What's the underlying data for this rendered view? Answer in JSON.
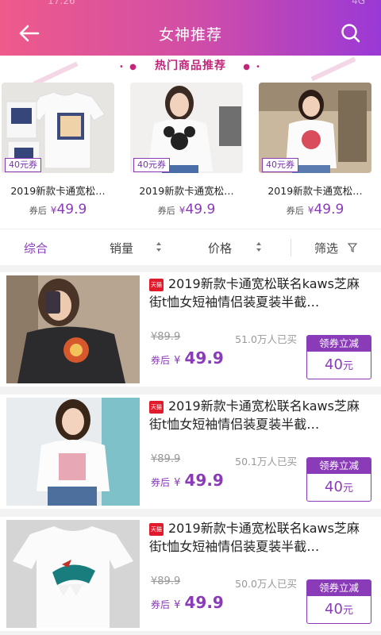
{
  "status_bar": {
    "time": "17:26",
    "signal": "4G"
  },
  "header": {
    "title": "女神推荐"
  },
  "hot": {
    "section_title": "热门商品推荐",
    "items": [
      {
        "coupon": "40元券",
        "name": "2019新款卡通宽松…",
        "price_label": "券后",
        "currency": "¥",
        "price": "49.9"
      },
      {
        "coupon": "40元券",
        "name": "2019新款卡通宽松…",
        "price_label": "券后",
        "currency": "¥",
        "price": "49.9"
      },
      {
        "coupon": "40元券",
        "name": "2019新款卡通宽松…",
        "price_label": "券后",
        "currency": "¥",
        "price": "49.9"
      }
    ]
  },
  "filter": {
    "items": [
      {
        "label": "综合"
      },
      {
        "label": "销量"
      },
      {
        "label": "价格"
      },
      {
        "label": "筛选"
      }
    ]
  },
  "products": [
    {
      "badge": "天猫",
      "name": "2019新款卡通宽松联名kaws芝麻街t恤女短袖情侣装夏装半截…",
      "original_price": "¥89.9",
      "sold": "51.0万人已买",
      "price_label": "券后",
      "currency": "¥",
      "price": "49.9",
      "coupon_label": "领券立减",
      "coupon_amount": "40",
      "coupon_unit": "元"
    },
    {
      "badge": "天猫",
      "name": "2019新款卡通宽松联名kaws芝麻街t恤女短袖情侣装夏装半截…",
      "original_price": "¥89.9",
      "sold": "50.1万人已买",
      "price_label": "券后",
      "currency": "¥",
      "price": "49.9",
      "coupon_label": "领券立减",
      "coupon_amount": "40",
      "coupon_unit": "元"
    },
    {
      "badge": "天猫",
      "name": "2019新款卡通宽松联名kaws芝麻街t恤女短袖情侣装夏装半截…",
      "original_price": "¥89.9",
      "sold": "50.0万人已买",
      "price_label": "券后",
      "currency": "¥",
      "price": "49.9",
      "coupon_label": "领券立减",
      "coupon_amount": "40",
      "coupon_unit": "元"
    }
  ],
  "colors": {
    "accent": "#8a3bb8",
    "header_start": "#ee5a8a",
    "header_end": "#9a39d6",
    "tmall_red": "#e21b2c"
  }
}
